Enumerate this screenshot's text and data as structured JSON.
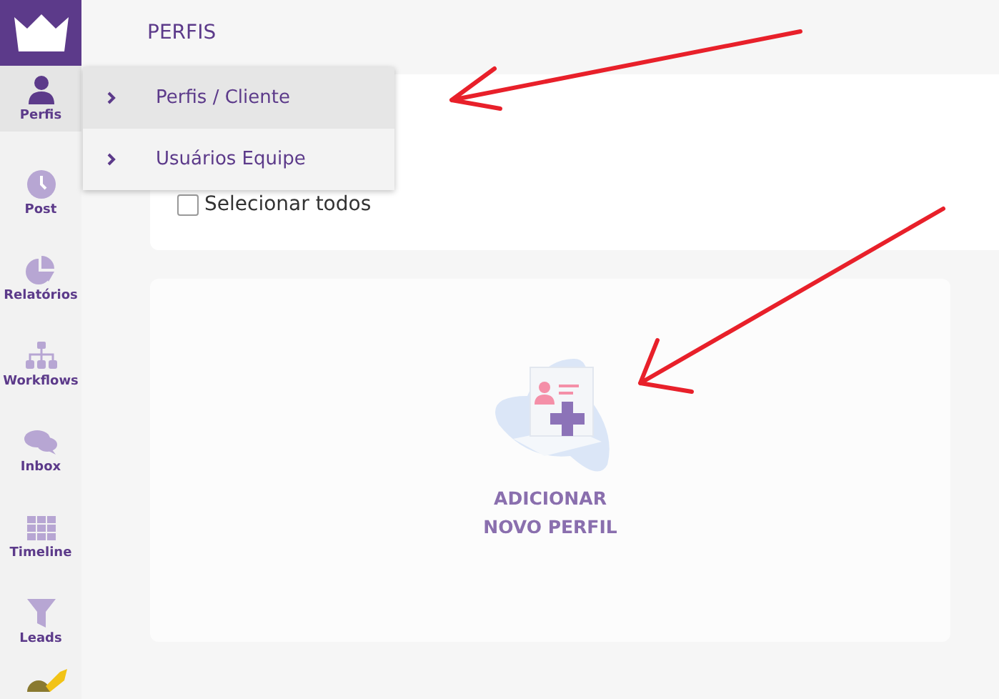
{
  "header": {
    "title": "PERFIS"
  },
  "sidebar": {
    "items": [
      {
        "label": "Perfis",
        "selected": true
      },
      {
        "label": "Post",
        "selected": false
      },
      {
        "label": "Relatórios",
        "selected": false
      },
      {
        "label": "Workflows",
        "selected": false
      },
      {
        "label": "Inbox",
        "selected": false
      },
      {
        "label": "Timeline",
        "selected": false
      },
      {
        "label": "Leads",
        "selected": false
      }
    ]
  },
  "menu": {
    "items": [
      {
        "label": "Perfis / Cliente",
        "selected": true
      },
      {
        "label": "Usuários Equipe",
        "selected": false
      }
    ]
  },
  "select_all": {
    "label": "Selecionar todos",
    "checked": false
  },
  "add_card": {
    "lines": [
      "ADICIONAR",
      "NOVO PERFIL"
    ]
  }
}
